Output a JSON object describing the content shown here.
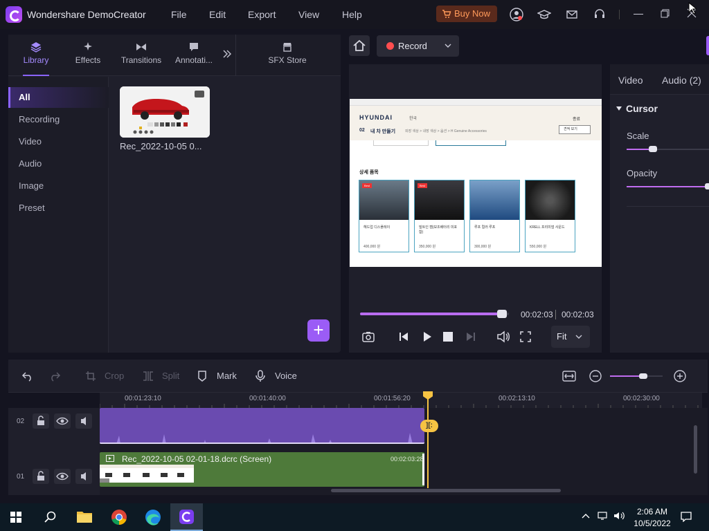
{
  "app": {
    "title": "Wondershare DemoCreator"
  },
  "menu": [
    {
      "label": "File"
    },
    {
      "label": "Edit"
    },
    {
      "label": "Export"
    },
    {
      "label": "View"
    },
    {
      "label": "Help"
    }
  ],
  "titlebar": {
    "buy_now": "Buy Now",
    "icons": [
      "account-icon",
      "academy-icon",
      "mail-icon",
      "support-icon"
    ],
    "accent": "#ff9a5a"
  },
  "library_tabs": [
    {
      "label": "Library",
      "icon": "layers-icon",
      "active": true
    },
    {
      "label": "Effects",
      "icon": "sparkle-icon"
    },
    {
      "label": "Transitions",
      "icon": "bowtie-icon"
    },
    {
      "label": "Annotati...",
      "icon": "comment-icon"
    },
    {
      "label": "SFX Store",
      "icon": "store-icon"
    }
  ],
  "sidebar": {
    "items": [
      {
        "label": "All",
        "active": true
      },
      {
        "label": "Recording"
      },
      {
        "label": "Video"
      },
      {
        "label": "Audio"
      },
      {
        "label": "Image"
      },
      {
        "label": "Preset"
      }
    ]
  },
  "media": {
    "thumb_label": "Rec_2022-10-05 0..."
  },
  "preview": {
    "record_label": "Record",
    "current_time": "00:02:03",
    "total_time": "00:02:03",
    "progress": 0.96,
    "zoom": "Fit",
    "screen": {
      "brand": "HYUNDAI",
      "lang": "한국",
      "crumb_num": "02",
      "crumb_title": "내 차 만들기",
      "crumb_path": "외장 색상  >  내장 색상  >  옵션  >  H Genuine Accessories",
      "top_right": "종료",
      "button": "견적 보기",
      "section": "상세 품목",
      "cards": [
        {
          "name": "헤드업 디스플레이",
          "price": "400,000 원",
          "badge": "Best"
        },
        {
          "name": "빌트인 캠(보조배터리 미포함)",
          "price": "350,000 원",
          "badge": "Best"
        },
        {
          "name": "루프 컬러 루프",
          "price": "300,000 원",
          "badge": ""
        },
        {
          "name": "KRELL 프리미엄 사운드",
          "price": "550,000 원",
          "badge": ""
        }
      ]
    }
  },
  "properties": {
    "tabs": [
      {
        "label": "Video"
      },
      {
        "label": "Audio (2)"
      }
    ],
    "section": "Cursor",
    "scale_label": "Scale",
    "opacity_label": "Opacity",
    "scale": 0.3,
    "opacity": 1.0
  },
  "timeline_toolbar": {
    "crop": "Crop",
    "split": "Split",
    "mark": "Mark",
    "voice": "Voice",
    "zoom_level": 0.55
  },
  "timeline": {
    "ticks": [
      "00:01:23:10",
      "00:01:40:00",
      "00:01:56:20",
      "00:02:13:10",
      "00:02:30:00"
    ],
    "tracks": [
      {
        "num": "02"
      },
      {
        "num": "01"
      }
    ],
    "clip_label": "Rec_2022-10-05 02-01-18.dcrc (Screen)",
    "clip_duration": "00:02:03:28",
    "split_badge": "][:"
  },
  "taskbar": {
    "time": "2:06 AM",
    "date": "10/5/2022"
  }
}
